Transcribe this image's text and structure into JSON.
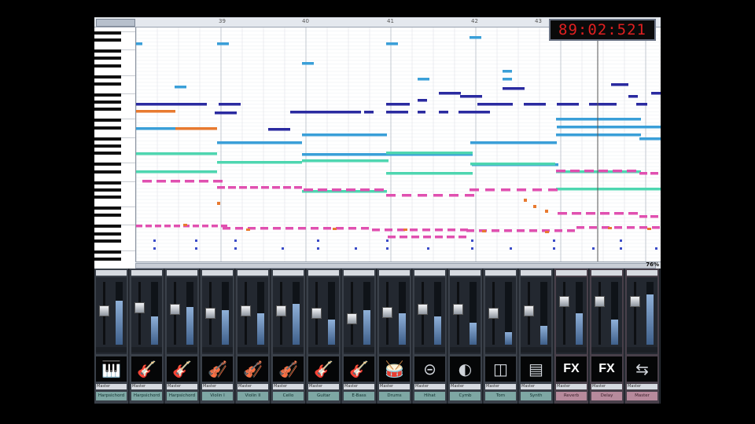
{
  "timecode": "89:02:521",
  "zoom_label": "76%",
  "ruler": {
    "bar_labels": [
      "39",
      "40",
      "41",
      "42",
      "43"
    ]
  },
  "colors": {
    "note_dark_blue": "#2a2aa0",
    "note_light_blue": "#3a9fd8",
    "note_teal": "#4ed6b0",
    "note_pink": "#e050b0",
    "note_orange": "#e87a30",
    "timecode_red": "#e02020"
  },
  "mixer": {
    "strips": [
      {
        "name": "Harpsichord",
        "icon": "keyboard-icon",
        "glyph": "🎹",
        "out": "Master"
      },
      {
        "name": "Harpsichord",
        "icon": "mandolin-icon",
        "glyph": "🎸",
        "out": "Master"
      },
      {
        "name": "Harpsichord",
        "icon": "guitar-icon",
        "glyph": "🎸",
        "out": "Master"
      },
      {
        "name": "Violin I",
        "icon": "strings-icon",
        "glyph": "🎻",
        "out": "Master"
      },
      {
        "name": "Violin II",
        "icon": "strings-icon",
        "glyph": "🎻",
        "out": "Master"
      },
      {
        "name": "Cello",
        "icon": "cello-icon",
        "glyph": "🎻",
        "out": "Master"
      },
      {
        "name": "Guitar",
        "icon": "guitar-icon",
        "glyph": "🎸",
        "out": "Master"
      },
      {
        "name": "E-Bass",
        "icon": "bass-icon",
        "glyph": "🎸",
        "out": "Master"
      },
      {
        "name": "Drums",
        "icon": "drums-icon",
        "glyph": "🥁",
        "out": "Master"
      },
      {
        "name": "Hihat",
        "icon": "hihat-icon",
        "glyph": "⊝",
        "out": "Master"
      },
      {
        "name": "Cymb",
        "icon": "cymbal-icon",
        "glyph": "◐",
        "out": "Master"
      },
      {
        "name": "Tom",
        "icon": "tom-icon",
        "glyph": "◫",
        "out": "Master"
      },
      {
        "name": "Synth",
        "icon": "synth-icon",
        "glyph": "▤",
        "out": "Master"
      },
      {
        "name": "Reverb",
        "icon": "fx-icon",
        "glyph": "FX",
        "out": "Master"
      },
      {
        "name": "Delay",
        "icon": "fx-icon",
        "glyph": "FX",
        "out": "Master"
      },
      {
        "name": "Master",
        "icon": "output-arrows-icon",
        "glyph": "⇆",
        "out": "Master"
      }
    ],
    "fader_levels": [
      0.55,
      0.6,
      0.58,
      0.5,
      0.55,
      0.55,
      0.5,
      0.4,
      0.52,
      0.58,
      0.58,
      0.5,
      0.55,
      0.72,
      0.72,
      0.72
    ],
    "meter_levels": [
      0.7,
      0.45,
      0.6,
      0.55,
      0.5,
      0.65,
      0.4,
      0.55,
      0.5,
      0.45,
      0.35,
      0.2,
      0.3,
      0.5,
      0.4,
      0.8
    ]
  }
}
